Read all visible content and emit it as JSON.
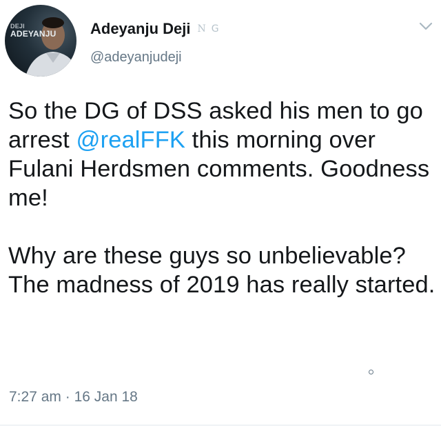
{
  "colors": {
    "text": "#14171a",
    "secondary": "#657786",
    "link": "#1da1f2",
    "divider": "#e1e8ed"
  },
  "tweet": {
    "avatar": {
      "overlay_line1": "DEJI",
      "overlay_line2": "ADEYANJU"
    },
    "display_name": "Adeyanju Deji",
    "badges": [
      "N",
      "G"
    ],
    "handle": "@adeyanjudeji",
    "menu_icon": "chevron-down-icon",
    "body": {
      "p1_part1": "So the DG of DSS asked his men to go arrest ",
      "p1_mention": "@realFFK",
      "p1_part2": " this morning over Fulani Herdsmen comments. Goodness me!",
      "p2": "Why are these guys so unbelievable? The madness of 2019 has really started."
    },
    "time": "7:27 am",
    "separator": "·",
    "date": "16 Jan 18"
  }
}
